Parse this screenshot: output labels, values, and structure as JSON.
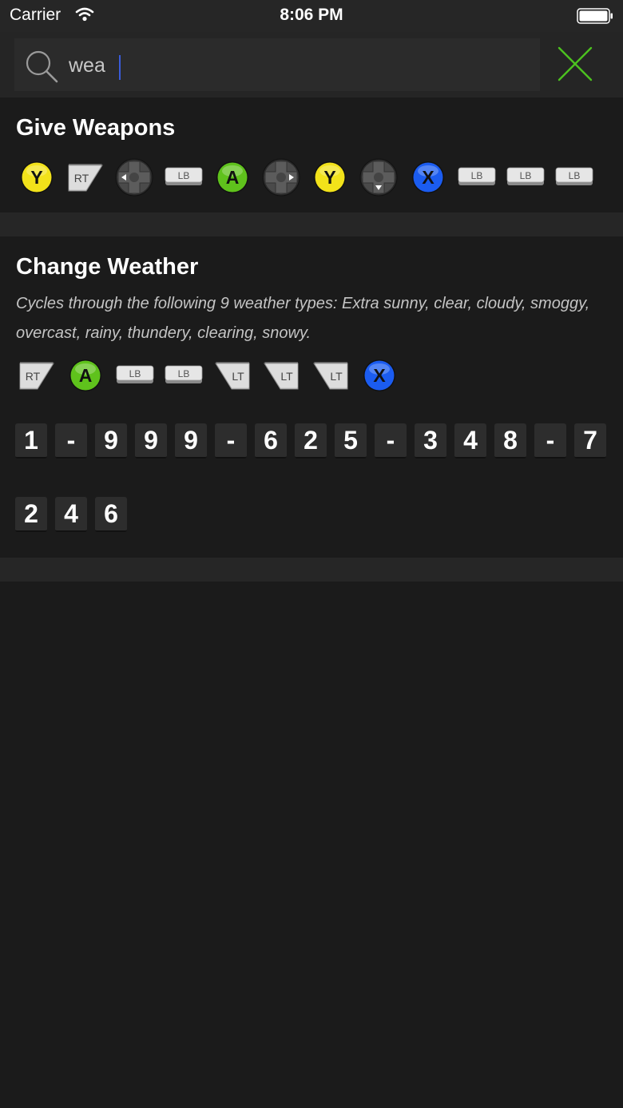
{
  "status_bar": {
    "carrier": "Carrier",
    "time": "8:06 PM"
  },
  "search": {
    "query": "wea",
    "icon": "search-icon",
    "close_icon": "close-icon",
    "close_color": "#4cc21f"
  },
  "cheats": [
    {
      "title": "Give Weapons",
      "description": "",
      "buttons": [
        "Y",
        "RT",
        "LEFT",
        "LB",
        "A",
        "RIGHT",
        "Y",
        "DOWN",
        "X",
        "LB",
        "LB",
        "LB"
      ],
      "phone": []
    },
    {
      "title": "Change Weather",
      "description": "Cycles through the following 9 weather types: Extra sunny, clear, cloudy, smoggy, overcast, rainy, thundery, clearing, snowy.",
      "buttons": [
        "RT",
        "A",
        "LB",
        "LB",
        "LT",
        "LT",
        "LT",
        "X"
      ],
      "phone": [
        "1",
        "-",
        "9",
        "9",
        "9",
        "-",
        "6",
        "2",
        "5",
        "-",
        "3",
        "4",
        "8",
        "-",
        "7",
        "2",
        "4",
        "6"
      ]
    }
  ],
  "colors": {
    "Y": "#f2e21a",
    "A": "#5fc21c",
    "X": "#1b5cf0",
    "background": "#1b1b1b",
    "separator": "#262626"
  }
}
